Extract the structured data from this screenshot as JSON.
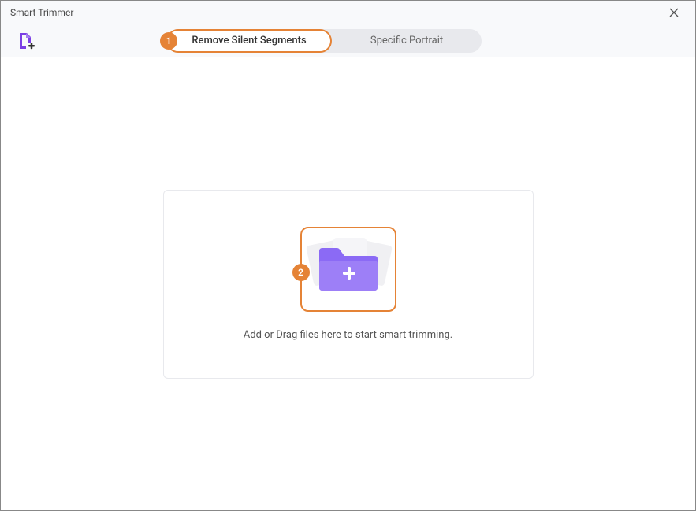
{
  "window": {
    "title": "Smart Trimmer"
  },
  "tabs": {
    "remove_silent": "Remove Silent Segments",
    "specific_portrait": "Specific Portrait"
  },
  "callouts": {
    "step1": "1",
    "step2": "2"
  },
  "dropzone": {
    "text": "Add or Drag files here to start smart trimming."
  }
}
